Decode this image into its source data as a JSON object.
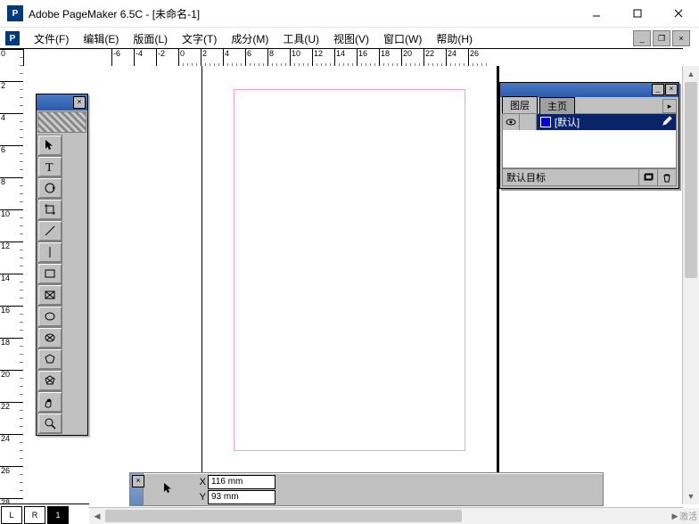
{
  "title": "Adobe PageMaker 6.5C - [未命名-1]",
  "menu": [
    "文件(F)",
    "编辑(E)",
    "版面(L)",
    "文字(T)",
    "成分(M)",
    "工具(U)",
    "视图(V)",
    "窗口(W)",
    "帮助(H)"
  ],
  "ruler": {
    "h_ticks": [
      0,
      2,
      4,
      6,
      8,
      10,
      12,
      14,
      16,
      18,
      20,
      22,
      24,
      26
    ],
    "v_ticks": [
      0,
      2,
      4,
      6,
      8,
      10,
      12,
      14,
      16,
      18,
      20,
      22,
      24,
      26,
      28
    ]
  },
  "toolbox": {
    "tools": [
      "pointer-tool",
      "text-tool",
      "rotate-tool",
      "crop-tool",
      "line-tool",
      "constrained-line-tool",
      "rectangle-tool",
      "rectangle-frame-tool",
      "ellipse-tool",
      "ellipse-frame-tool",
      "polygon-tool",
      "polygon-frame-tool",
      "hand-tool",
      "zoom-tool"
    ]
  },
  "control_bar": {
    "x_label": "X",
    "y_label": "Y",
    "x_value": "116 mm",
    "y_value": "93 mm"
  },
  "layers": {
    "tab1": "图层",
    "tab2": "主页",
    "default_layer": "[默认]",
    "target_label": "默认目标"
  },
  "page_tabs": {
    "left_master": "L",
    "right_master": "R",
    "page1": "1"
  },
  "brand_hint": "激活"
}
